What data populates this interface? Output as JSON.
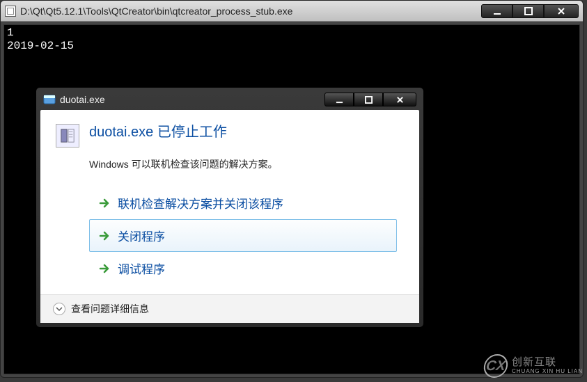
{
  "console": {
    "title": "D:\\Qt\\Qt5.12.1\\Tools\\QtCreator\\bin\\qtcreator_process_stub.exe",
    "lines": [
      "1",
      "2019-02-15"
    ]
  },
  "dialog": {
    "title": "duotai.exe",
    "heading": "duotai.exe 已停止工作",
    "subtext": "Windows 可以联机检查该问题的解决方案。",
    "actions": [
      {
        "label": "联机检查解决方案并关闭该程序",
        "selected": false
      },
      {
        "label": "关闭程序",
        "selected": true
      },
      {
        "label": "调试程序",
        "selected": false
      }
    ],
    "footer": "查看问题详细信息"
  },
  "watermark": {
    "cn": "创新互联",
    "en": "CHUANG XIN HU LIAN",
    "logo": "CX"
  }
}
